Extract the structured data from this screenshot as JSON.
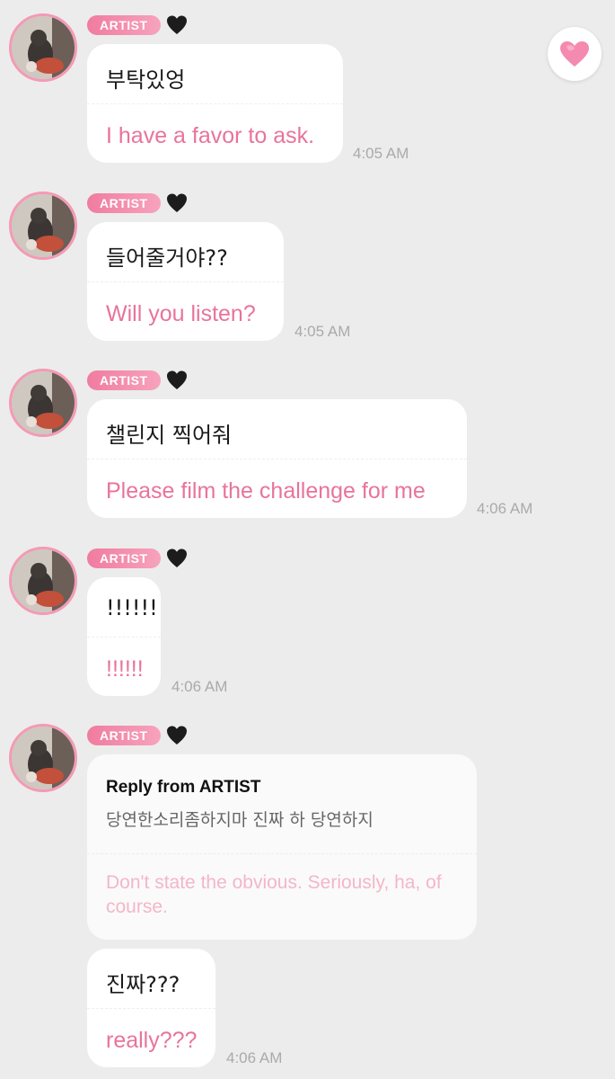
{
  "fab": {
    "icon": "heart-icon",
    "color": "#f48ab0"
  },
  "badge_color": "#f07ca0",
  "messages": [
    {
      "badge": "ARTIST",
      "heart_icon": "black-heart-icon",
      "korean": "부탁있엉",
      "english": "I have a favor to ask.",
      "time": "4:05 AM"
    },
    {
      "badge": "ARTIST",
      "heart_icon": "black-heart-icon",
      "korean": "들어줄거야??",
      "english": "Will you listen?",
      "time": "4:05 AM"
    },
    {
      "badge": "ARTIST",
      "heart_icon": "black-heart-icon",
      "korean": "챌린지 찍어줘",
      "english": "Please film the challenge for me",
      "time": "4:06 AM"
    },
    {
      "badge": "ARTIST",
      "heart_icon": "black-heart-icon",
      "korean": "!!!!!!",
      "english": "!!!!!!",
      "time": "4:06 AM"
    }
  ],
  "reply_group": {
    "badge": "ARTIST",
    "heart_icon": "black-heart-icon",
    "reply_title": "Reply from ARTIST",
    "reply_korean": "당연한소리좀하지마 진짜 하 당연하지",
    "reply_english": "Don't state the obvious. Seriously, ha, of course.",
    "followup": {
      "korean": "진짜???",
      "english": "really???",
      "time": "4:06 AM"
    }
  }
}
